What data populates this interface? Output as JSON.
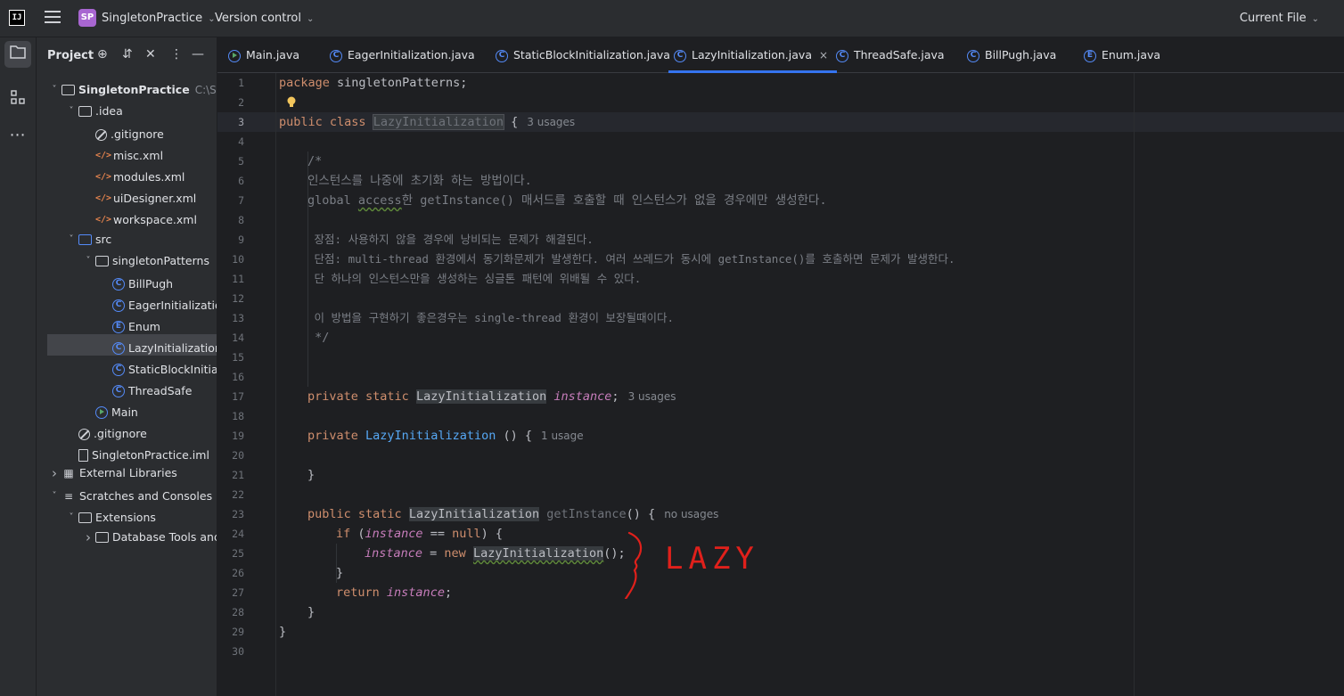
{
  "titlebar": {
    "logo_text": "IJ",
    "project_badge": "SP",
    "project_name": "SingletonPractice",
    "version_control": "Version control",
    "current_file": "Current File"
  },
  "project_panel": {
    "title": "Project",
    "tree": [
      {
        "label": "SingletonPractice",
        "hint": "C:\\Sing",
        "icon": "module-folder-icon",
        "depth": 0,
        "arrow": "down",
        "bold": true
      },
      {
        "label": ".idea",
        "icon": "folder-icon",
        "depth": 1,
        "arrow": "down"
      },
      {
        "label": ".gitignore",
        "icon": "ignore-file-icon",
        "depth": 2
      },
      {
        "label": "misc.xml",
        "icon": "xml-file-icon",
        "depth": 2
      },
      {
        "label": "modules.xml",
        "icon": "xml-file-icon",
        "depth": 2
      },
      {
        "label": "uiDesigner.xml",
        "icon": "xml-file-icon",
        "depth": 2
      },
      {
        "label": "workspace.xml",
        "icon": "xml-file-icon",
        "depth": 2
      },
      {
        "label": "src",
        "icon": "source-folder-icon",
        "depth": 1,
        "arrow": "down"
      },
      {
        "label": "singletonPatterns",
        "icon": "package-icon",
        "depth": 2,
        "arrow": "down"
      },
      {
        "label": "BillPugh",
        "icon": "class-icon",
        "depth": 3
      },
      {
        "label": "EagerInitialization",
        "icon": "class-icon",
        "depth": 3
      },
      {
        "label": "Enum",
        "icon": "enum-icon",
        "depth": 3
      },
      {
        "label": "LazyInitialization",
        "icon": "class-icon",
        "depth": 3,
        "selected": true
      },
      {
        "label": "StaticBlockInitializ",
        "icon": "class-icon",
        "depth": 3
      },
      {
        "label": "ThreadSafe",
        "icon": "class-icon",
        "depth": 3
      },
      {
        "label": "Main",
        "icon": "main-class-icon",
        "depth": 2
      },
      {
        "label": ".gitignore",
        "icon": "ignore-file-icon",
        "depth": 1
      },
      {
        "label": "SingletonPractice.iml",
        "icon": "iml-file-icon",
        "depth": 1
      },
      {
        "label": "External Libraries",
        "icon": "library-icon",
        "depth": 0,
        "arrow": "right"
      },
      {
        "label": "Scratches and Consoles",
        "icon": "scratches-icon",
        "depth": 0,
        "arrow": "down"
      },
      {
        "label": "Extensions",
        "icon": "folder-icon",
        "depth": 1,
        "arrow": "down"
      },
      {
        "label": "Database Tools and S",
        "icon": "folder-icon",
        "depth": 2,
        "arrow": "right"
      }
    ]
  },
  "tabs": [
    {
      "label": "Main.java",
      "icon": "main-class-icon"
    },
    {
      "label": "EagerInitialization.java",
      "icon": "class-icon"
    },
    {
      "label": "StaticBlockInitialization.java",
      "icon": "class-icon"
    },
    {
      "label": "LazyInitialization.java",
      "icon": "class-icon",
      "active": true,
      "close": "×"
    },
    {
      "label": "ThreadSafe.java",
      "icon": "class-icon"
    },
    {
      "label": "BillPugh.java",
      "icon": "class-icon"
    },
    {
      "label": "Enum.java",
      "icon": "enum-icon"
    }
  ],
  "editor": {
    "line_numbers": [
      "1",
      "2",
      "3",
      "4",
      "5",
      "6",
      "7",
      "8",
      "9",
      "10",
      "11",
      "12",
      "13",
      "14",
      "15",
      "16",
      "17",
      "18",
      "19",
      "20",
      "21",
      "22",
      "23",
      "24",
      "25",
      "26",
      "27",
      "28",
      "29",
      "30"
    ],
    "current_line": "3",
    "code": {
      "l1_kw": "package",
      "l1_rest": " singletonPatterns;",
      "l3_kw": "public class",
      "l3_cls": "LazyInitialization",
      "l3_brace": " {",
      "l3_hint": "3 usages",
      "l5": "/*",
      "l6": "인스턴스를 나중에 초기화 하는 방법이다.",
      "l7_a": "global ",
      "l7_b": "access",
      "l7_c": "한 getInstance() 매서드를 호출할 때 인스턴스가 없을 경우에만 생성한다.",
      "l9": " 장점: 사용하지 않을 경우에 낭비되는 문제가 해결된다.",
      "l10": " 단점: multi-thread 환경에서 동기화문제가 발생한다. 여러 쓰레드가 동시에 getInstance()를 호출하면 문제가 발생한다.",
      "l11": " 단 하나의 인스턴스만을 생성하는 싱글톤 패턴에 위배될 수 있다.",
      "l13": " 이 방법을 구현하기 좋은경우는 single-thread 환경이 보장될때이다.",
      "l14": " */",
      "l17_kw": "private static",
      "l17_cls": "LazyInitialization",
      "l17_field": "instance",
      "l17_semi": ";",
      "l17_hint": "3 usages",
      "l19_kw": "private",
      "l19_meth": "LazyInitialization",
      "l19_rest": " () {",
      "l19_hint": "1 usage",
      "l21": "}",
      "l23_kw": "public static",
      "l23_cls": "LazyInitialization",
      "l23_meth": "getInstance",
      "l23_rest": "() {",
      "l23_hint": "no usages",
      "l24_kw": "if",
      "l24_a": " (",
      "l24_field": "instance",
      "l24_b": " == ",
      "l24_null": "null",
      "l24_c": ") {",
      "l25_field": "instance",
      "l25_a": " = ",
      "l25_kw": "new",
      "l25_cls": "LazyInitialization",
      "l25_b": "();",
      "l26": "}",
      "l27_kw": "return",
      "l27_field": "instance",
      "l27_semi": ";",
      "l28": "}",
      "l29": "}"
    },
    "annotation": "LAZY",
    "annotation_color": "#e0201b"
  },
  "colors": {
    "keyword": "#cf8e6d",
    "field": "#c77dbb",
    "method": "#56a8f5",
    "comment": "#7a7e85",
    "accent": "#3574f0"
  }
}
